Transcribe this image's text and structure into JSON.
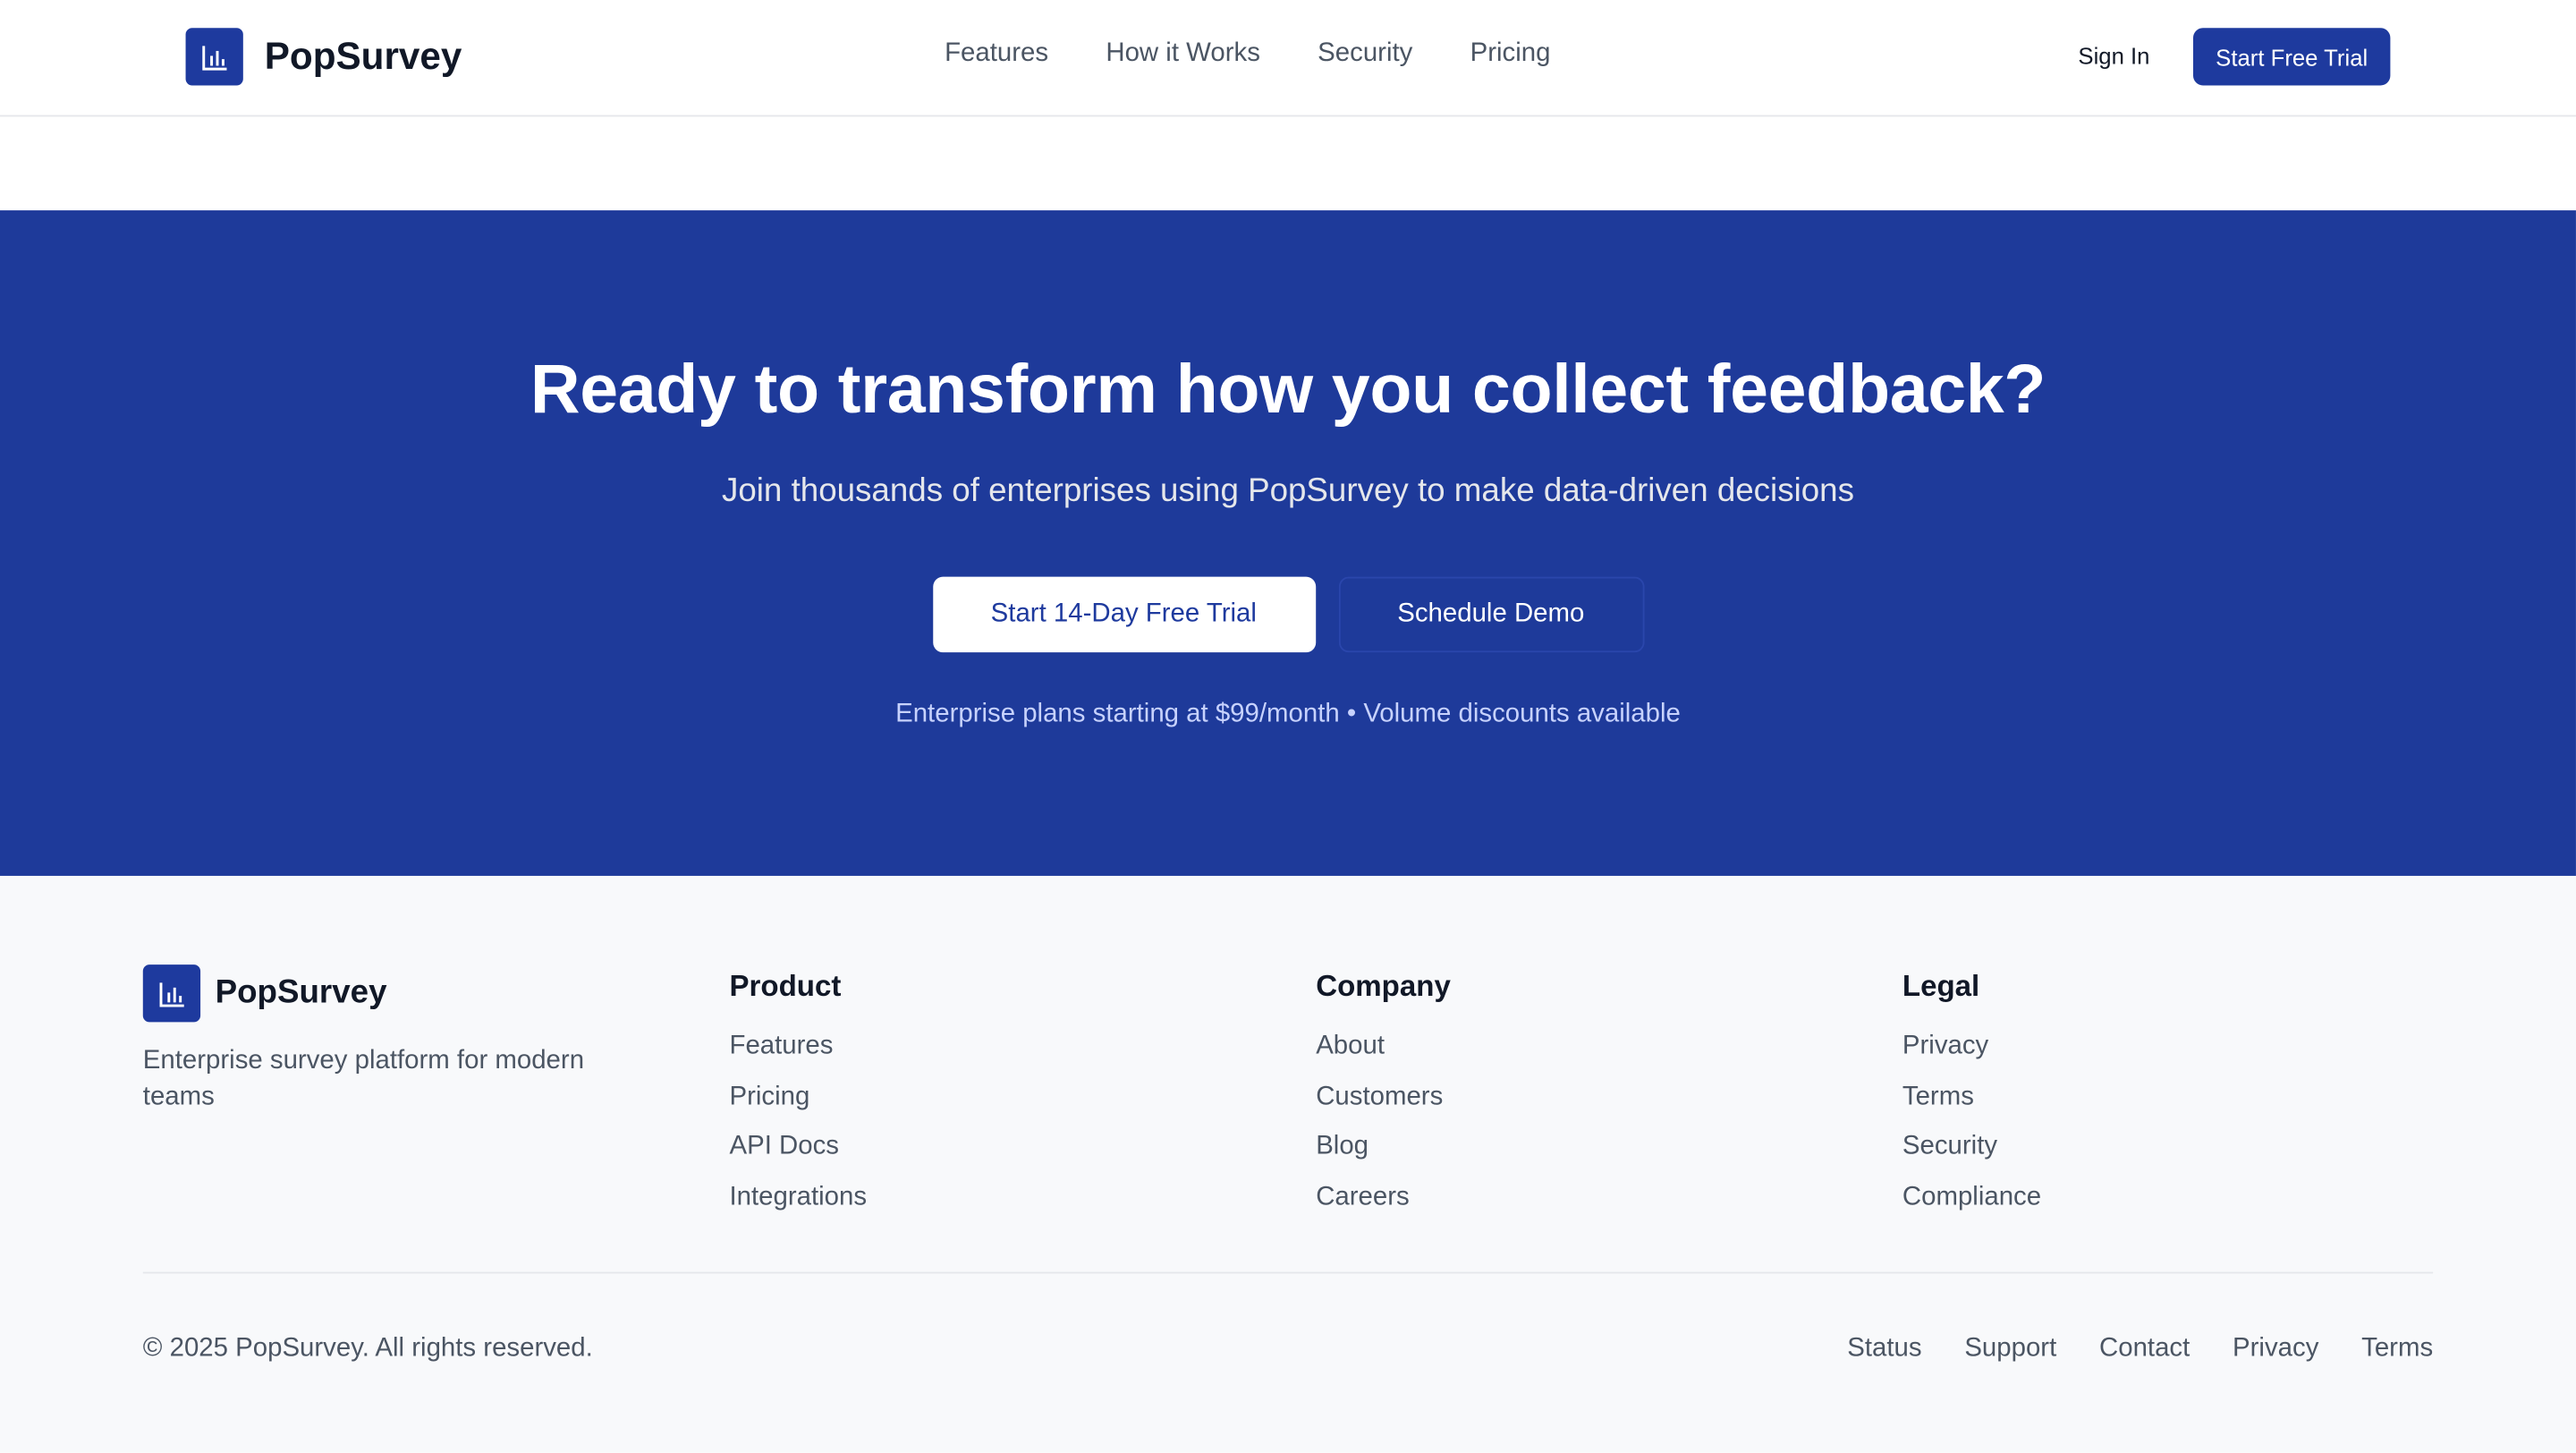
{
  "header": {
    "brand": "PopSurvey",
    "nav": [
      "Features",
      "How it Works",
      "Security",
      "Pricing"
    ],
    "sign_in": "Sign In",
    "cta": "Start Free Trial"
  },
  "cta_section": {
    "title": "Ready to transform how you collect feedback?",
    "subtitle": "Join thousands of enterprises using PopSurvey to make data-driven decisions",
    "primary_button": "Start 14-Day Free Trial",
    "secondary_button": "Schedule Demo",
    "note": "Enterprise plans starting at $99/month • Volume discounts available"
  },
  "footer": {
    "brand": "PopSurvey",
    "tagline": "Enterprise survey platform for modern teams",
    "columns": [
      {
        "title": "Product",
        "links": [
          "Features",
          "Pricing",
          "API Docs",
          "Integrations"
        ]
      },
      {
        "title": "Company",
        "links": [
          "About",
          "Customers",
          "Blog",
          "Careers"
        ]
      },
      {
        "title": "Legal",
        "links": [
          "Privacy",
          "Terms",
          "Security",
          "Compliance"
        ]
      }
    ],
    "copyright": "© 2025 PopSurvey. All rights reserved.",
    "bottom_links": [
      "Status",
      "Support",
      "Contact",
      "Privacy",
      "Terms"
    ]
  },
  "colors": {
    "brand": "#1e3a9e",
    "band": "#1e3a9a",
    "footer_bg": "#f8f9fb"
  },
  "icons": {
    "logo": "bar-chart-icon"
  }
}
